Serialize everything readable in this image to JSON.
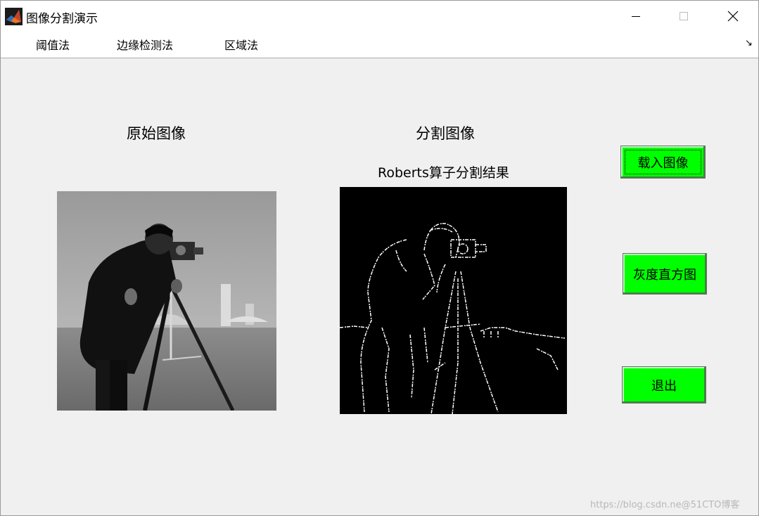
{
  "window": {
    "title": "图像分割演示",
    "icon": "matlab-icon"
  },
  "menu": {
    "items": [
      "阈值法",
      "边缘检测法",
      "区域法"
    ],
    "toolbar_toggle_glyph": "↘"
  },
  "labels": {
    "original": "原始图像",
    "segmented": "分割图像",
    "result_title": "Roberts算子分割结果"
  },
  "buttons": {
    "load": "载入图像",
    "histogram": "灰度直方图",
    "exit": "退出"
  },
  "watermark": "https://blog.csdn.ne@51CTO博客",
  "colors": {
    "button_green": "#00ff00",
    "panel_bg": "#f0f0f0",
    "edge_white": "#ffffff",
    "seg_bg": "#000000"
  }
}
